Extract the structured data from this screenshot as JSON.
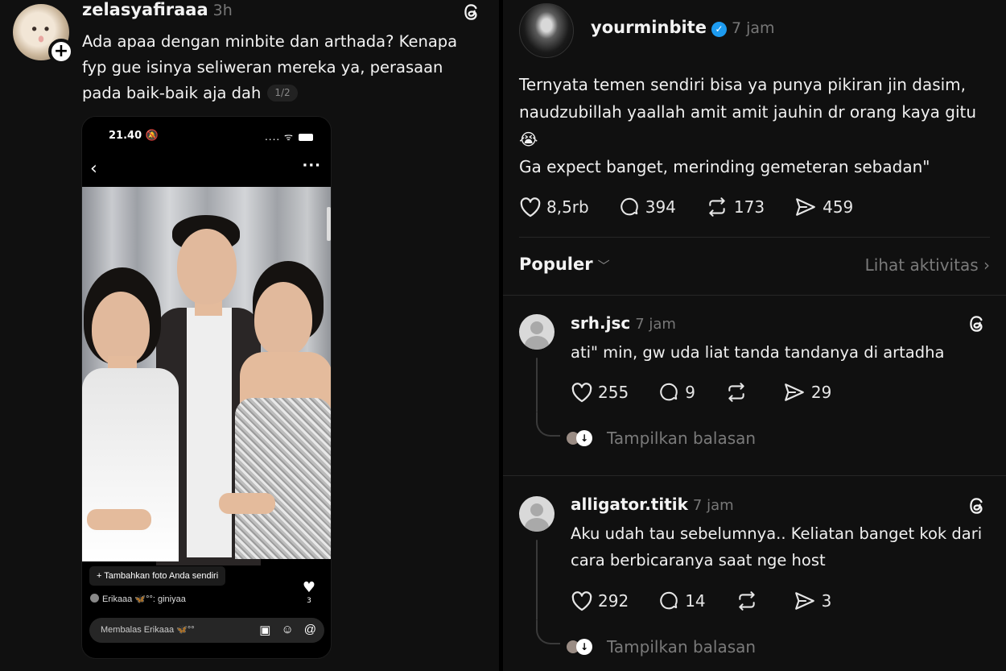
{
  "left_post": {
    "username": "zelasyafiraaa",
    "time": "3h",
    "text": "Ada apaa dengan minbite dan arthada? Kenapa fyp gue isinya seliweran mereka ya, perasaan pada baik-baik aja dah",
    "pager": "1/2",
    "phone": {
      "status_time": "21.40",
      "status_signal": "....",
      "add_photo_label": "+ Tambahkan foto Anda sendiri",
      "like_count": "3",
      "reply_user": "Erikaaa",
      "reply_text": "°°: giniyaa",
      "reply_placeholder": "Membalas Erikaaa 🦋°°"
    }
  },
  "right_post": {
    "username": "yourminbite",
    "time": "7 jam",
    "text_lines": [
      "Ternyata temen sendiri bisa ya punya pikiran jin dasim, naudzubillah yaallah amit amit jauhin dr orang kaya gitu😭",
      "Ga expect banget, merinding gemeteran sebadan\""
    ],
    "likes": "8,5rb",
    "comments": "394",
    "reposts": "173",
    "shares": "459"
  },
  "section": {
    "sort_label": "Populer",
    "activity_link": "Lihat aktivitas"
  },
  "comments": [
    {
      "username": "srh.jsc",
      "time": "7 jam",
      "text": "ati\" min, gw uda liat tanda tandanya di artadha",
      "likes": "255",
      "comments": "9",
      "shares": "29",
      "show_replies": "Tampilkan balasan"
    },
    {
      "username": "alligator.titik",
      "time": "7 jam",
      "text": "Aku udah tau sebelumnya.. Keliatan banget kok dari cara berbicaranya saat nge host",
      "likes": "292",
      "comments": "14",
      "shares": "3",
      "show_replies": "Tampilkan balasan"
    }
  ],
  "icons": {
    "threads": "threads-icon",
    "heart": "heart-icon",
    "comment": "comment-icon",
    "repost": "repost-icon",
    "share": "share-icon"
  },
  "colors": {
    "background": "#101010",
    "text": "#f3f3f3",
    "muted": "#777777",
    "verified": "#1d9bf0"
  }
}
